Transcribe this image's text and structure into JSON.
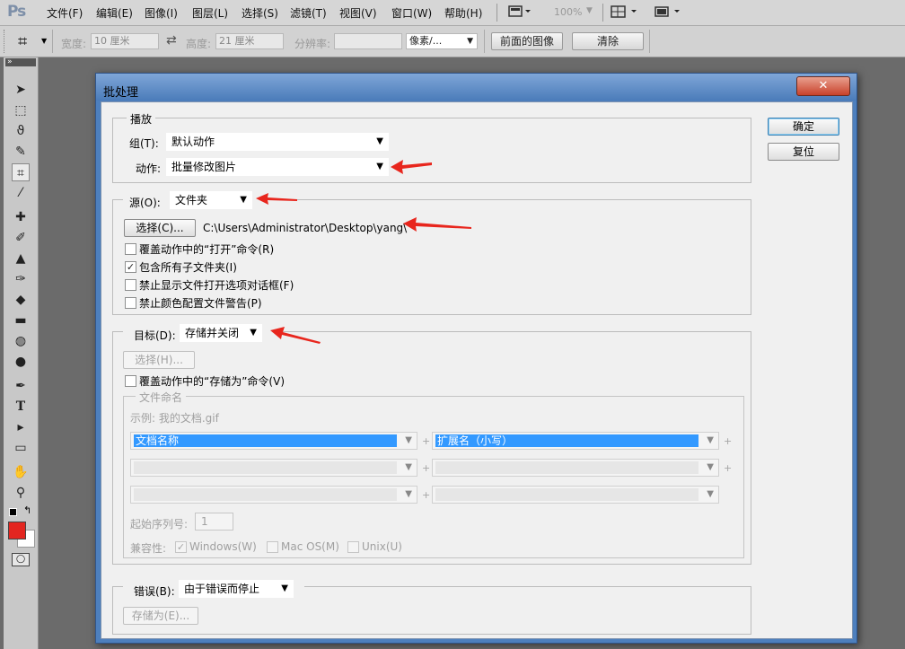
{
  "app": {
    "logo": "Ps",
    "menu": [
      "文件(F)",
      "编辑(E)",
      "图像(I)",
      "图层(L)",
      "选择(S)",
      "滤镜(T)",
      "视图(V)",
      "窗口(W)",
      "帮助(H)"
    ],
    "zoom": "100%"
  },
  "options_bar": {
    "width_label": "宽度:",
    "width_value": "10 厘米",
    "height_label": "高度:",
    "height_value": "21 厘米",
    "resolution_label": "分辨率:",
    "resolution_value": "",
    "unit_value": "像素/...",
    "front_image_button": "前面的图像",
    "clear_button": "清除"
  },
  "dialog": {
    "title": "批处理",
    "close_glyph": "✕",
    "ok_button": "确定",
    "reset_button": "复位",
    "play": {
      "legend": "播放",
      "set_label": "组(T):",
      "set_value": "默认动作",
      "action_label": "动作:",
      "action_value": "批量修改图片"
    },
    "source": {
      "label": "源(O):",
      "value": "文件夹",
      "choose_button": "选择(C)...",
      "path": "C:\\Users\\Administrator\\Desktop\\yang\\",
      "options": [
        {
          "label": "覆盖动作中的“打开”命令(R)",
          "checked": false
        },
        {
          "label": "包含所有子文件夹(I)",
          "checked": true
        },
        {
          "label": "禁止显示文件打开选项对话框(F)",
          "checked": false
        },
        {
          "label": "禁止颜色配置文件警告(P)",
          "checked": false
        }
      ]
    },
    "destination": {
      "label": "目标(D):",
      "value": "存储并关闭",
      "choose_button": "选择(H)...",
      "override_label": "覆盖动作中的“存储为”命令(V)",
      "override_checked": false,
      "naming": {
        "legend": "文件命名",
        "example": "示例: 我的文档.gif",
        "fields": [
          "文档名称",
          "扩展名（小写）",
          "",
          "",
          "",
          ""
        ],
        "serial_label": "起始序列号:",
        "serial_value": "1",
        "compat_label": "兼容性:",
        "compat": [
          {
            "label": "Windows(W)",
            "checked": true
          },
          {
            "label": "Mac OS(M)",
            "checked": false
          },
          {
            "label": "Unix(U)",
            "checked": false
          }
        ]
      }
    },
    "errors": {
      "label": "错误(B):",
      "value": "由于错误而停止",
      "save_as_button": "存储为(E)..."
    }
  },
  "annotation_color": "#e8261d"
}
